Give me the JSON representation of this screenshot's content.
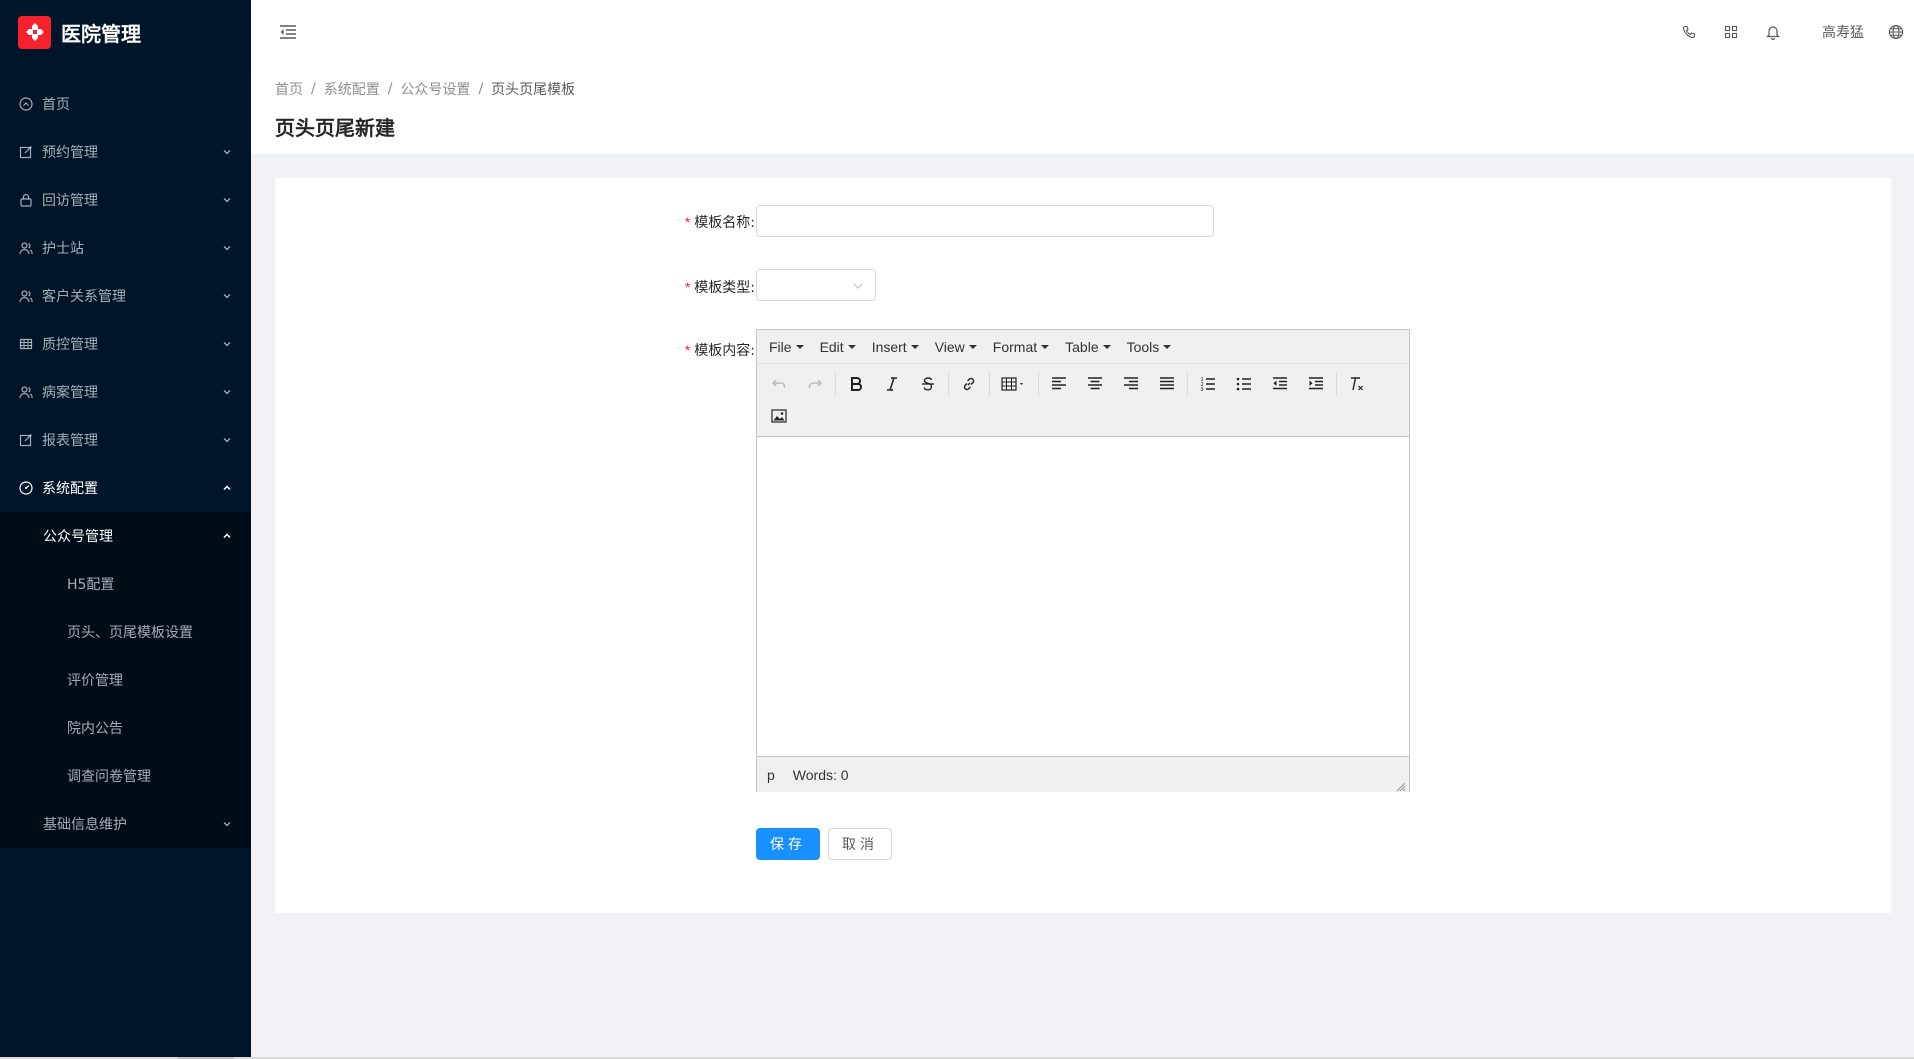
{
  "app": {
    "title": "医院管理"
  },
  "sidebar": {
    "items": [
      {
        "label": "首页",
        "icon": "dashboard-icon",
        "has_children": false
      },
      {
        "label": "预约管理",
        "icon": "form-icon",
        "has_children": true
      },
      {
        "label": "回访管理",
        "icon": "lock-icon",
        "has_children": true
      },
      {
        "label": "护士站",
        "icon": "team-icon",
        "has_children": true
      },
      {
        "label": "客户关系管理",
        "icon": "team-icon",
        "has_children": true
      },
      {
        "label": "质控管理",
        "icon": "table-icon",
        "has_children": true
      },
      {
        "label": "病案管理",
        "icon": "team-icon",
        "has_children": true
      },
      {
        "label": "报表管理",
        "icon": "form-icon",
        "has_children": true
      },
      {
        "label": "系统配置",
        "icon": "dashboard-icon",
        "has_children": true,
        "open": true
      }
    ],
    "system_config": {
      "public_account": {
        "label": "公众号管理",
        "children": [
          "H5配置",
          "页头、页尾模板设置",
          "评价管理",
          "院内公告",
          "调查问卷管理"
        ]
      },
      "basic_info": {
        "label": "基础信息维护"
      }
    }
  },
  "header": {
    "user_name": "高寿猛",
    "icons": [
      "phone-icon",
      "appstore-icon",
      "bell-icon",
      "global-icon"
    ]
  },
  "breadcrumb": [
    "首页",
    "系统配置",
    "公众号设置",
    "页头页尾模板"
  ],
  "breadcrumb_separator": "/",
  "page": {
    "title": "页头页尾新建"
  },
  "form": {
    "name_label": "模板名称:",
    "name_value": "",
    "type_label": "模板类型:",
    "type_value": "",
    "content_label": "模板内容:",
    "required_mark": "*"
  },
  "editor": {
    "menus": [
      "File",
      "Edit",
      "Insert",
      "View",
      "Format",
      "Table",
      "Tools"
    ],
    "status_path": "p",
    "word_count": "Words: 0"
  },
  "actions": {
    "save": "保存",
    "cancel": "取消"
  },
  "colors": {
    "sider_bg": "#001529",
    "primary": "#1890ff",
    "logo": "#f5222d",
    "required": "#f5222d"
  }
}
